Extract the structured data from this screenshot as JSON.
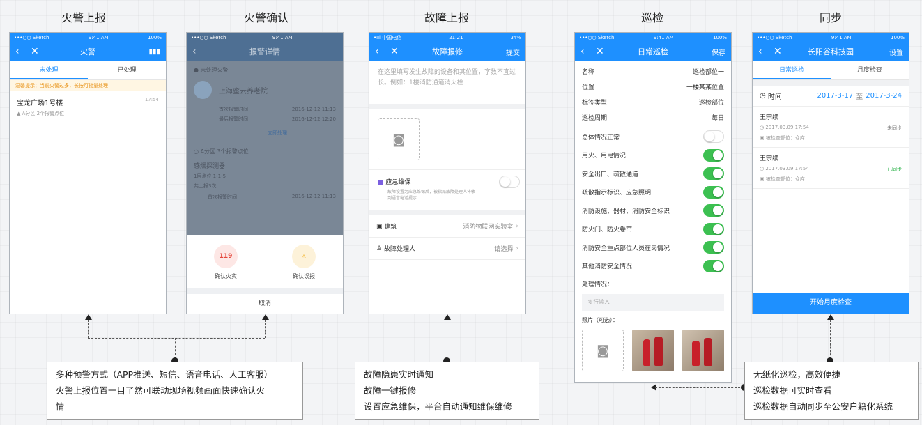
{
  "sections": {
    "fire_report": "火警上报",
    "fire_confirm": "火警确认",
    "fault_report": "故障上报",
    "patrol": "巡检",
    "sync": "同步"
  },
  "phone1": {
    "status": {
      "carrier": "•••○○ Sketch",
      "time": "9:41 AM",
      "battery": "100%"
    },
    "nav_title": "火警",
    "tabs": [
      "未处理",
      "已处理"
    ],
    "note": "温馨提示：当前火警过多，长按可批量处理",
    "item": {
      "title": "宝龙广场1号楼",
      "time": "17:54",
      "sub": "A分区  2个报警点位"
    }
  },
  "phone2": {
    "status": {
      "carrier": "•••○○ Sketch",
      "time": "9:41 AM"
    },
    "nav_title": "报警详情",
    "head": "● 未处理火警",
    "name": "上海蜜云养老院",
    "rows": [
      {
        "k": "首次报警时间",
        "v": "2016-12-12 11:13"
      },
      {
        "k": "最后报警时间",
        "v": "2016-12-12 12:20"
      }
    ],
    "action": "立即处理",
    "zone": "○ A分区  3个报警点位",
    "detector": "感烟探测器",
    "d1": "1层点位  1-1-5",
    "d2": "共上报3次",
    "d_row": {
      "k": "首次报警时间",
      "v": "2016-12-12 11:13"
    },
    "btn_fire": "确认火灾",
    "btn_fire_icon": "119",
    "btn_false": "确认误报",
    "cancel": "取消"
  },
  "phone3": {
    "status": {
      "carrier": "•ııl 中国电信",
      "time": "21:21",
      "battery": "34%"
    },
    "nav_title": "故障报修",
    "nav_right": "提交",
    "placeholder": "在这里填写发生故障的设备和其位置，字数不宜过长。例如：1楼消防通道消火栓",
    "emergency": "应急维保",
    "emergency_desc": "故障设置为应急维保后，被指派故障处理人将收到语音电话提示",
    "building_label": "建筑",
    "building_value": "消防物联网实验室",
    "handler_label": "故障处理人",
    "handler_value": "请选择"
  },
  "phone4": {
    "status": {
      "carrier": "•••○○ Sketch",
      "time": "9:41 AM",
      "battery": "100%"
    },
    "nav_title": "日常巡检",
    "nav_right": "保存",
    "info": [
      {
        "k": "名称",
        "v": "巡检部位一"
      },
      {
        "k": "位置",
        "v": "一楼某某位置"
      },
      {
        "k": "标签类型",
        "v": "巡检部位"
      },
      {
        "k": "巡检周期",
        "v": "每日"
      }
    ],
    "toggles": [
      {
        "k": "总体情况正常",
        "on": false
      },
      {
        "k": "用火、用电情况",
        "on": true
      },
      {
        "k": "安全出口、疏散通道",
        "on": true
      },
      {
        "k": "疏散指示标识、应急照明",
        "on": true
      },
      {
        "k": "消防设施、器材、消防安全标识",
        "on": true
      },
      {
        "k": "防火门、防火卷帘",
        "on": true
      },
      {
        "k": "消防安全重点部位人员在岗情况",
        "on": true
      },
      {
        "k": "其他消防安全情况",
        "on": true
      }
    ],
    "handle_label": "处理情况：",
    "handle_placeholder": "多行输入",
    "photo_label": "照片（可选）："
  },
  "phone5": {
    "status": {
      "carrier": "•••○○ Sketch",
      "time": "9:41 AM",
      "battery": "100%"
    },
    "nav_title": "长阳谷科技园",
    "nav_right": "设置",
    "tabs": [
      "日常巡检",
      "月度检查"
    ],
    "time_label": "时间",
    "date_from": "2017-3-17",
    "date_to_word": "至",
    "date_to": "2017-3-24",
    "records": [
      {
        "name": "王宗续",
        "time": "2017.03.09 17:54",
        "place": "被检查部位：仓库",
        "status": "未同步",
        "status_color": "#888888"
      },
      {
        "name": "王宗续",
        "time": "2017.03.09 17:54",
        "place": "被检查部位：仓库",
        "status": "已同步",
        "status_color": "#2cb34a"
      }
    ],
    "bottom_button": "开始月度检查"
  },
  "captions": {
    "left": [
      "多种预警方式（APP推送、短信、语音电话、人工客服）",
      "火警上报位置一目了然可联动现场视频画面快速确认火",
      "情"
    ],
    "middle": [
      "故障隐患实时通知",
      "故障一键报修",
      "设置应急维保，平台自动通知维保维修"
    ],
    "right": [
      "无纸化巡检，高效便捷",
      "巡检数据可实时查看",
      "巡检数据自动同步至公安户籍化系统"
    ]
  },
  "accent": "#1e90ff"
}
